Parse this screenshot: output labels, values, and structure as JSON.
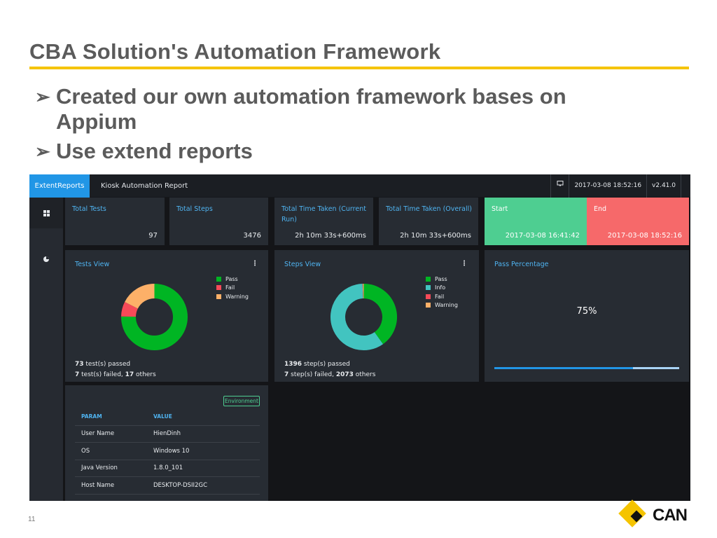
{
  "slide": {
    "title": "CBA Solution's Automation Framework",
    "bullets": [
      "Created our own automation framework bases on Appium",
      "Use extend reports"
    ],
    "page_number": "11",
    "logo_text": "CAN",
    "accent_color": "#f5c400"
  },
  "app": {
    "brand": "ExtentReports",
    "report_name": "Kiosk Automation Report",
    "topbar": {
      "monitor_icon": "monitor-icon",
      "datetime": "2017-03-08 18:52:16",
      "version": "v2.41.0"
    },
    "nav": [
      {
        "icon": "dashboard-icon",
        "active": true
      },
      {
        "icon": "pie-chart-icon",
        "active": false
      }
    ],
    "stats": [
      {
        "label": "Total Tests",
        "value": "97"
      },
      {
        "label": "Total Steps",
        "value": "3476"
      },
      {
        "label": "Total Time Taken (Current Run)",
        "value": "2h 10m 33s+600ms"
      },
      {
        "label": "Total Time Taken (Overall)",
        "value": "2h 10m 33s+600ms"
      },
      {
        "label": "Start",
        "value": "2017-03-08 16:41:42",
        "color": "#4ece91"
      },
      {
        "label": "End",
        "value": "2017-03-08 18:52:16",
        "color": "#f6696a"
      }
    ],
    "tests_view": {
      "title": "Tests View",
      "legend": [
        {
          "label": "Pass",
          "color": "#00b523"
        },
        {
          "label": "Fail",
          "color": "#f74a58"
        },
        {
          "label": "Warning",
          "color": "#fdb068"
        }
      ],
      "summary_line1_num": "73",
      "summary_line1_text": " test(s) passed",
      "summary_line2_num_a": "7",
      "summary_line2_mid": " test(s) failed, ",
      "summary_line2_num_b": "17",
      "summary_line2_end": " others"
    },
    "steps_view": {
      "title": "Steps View",
      "legend": [
        {
          "label": "Pass",
          "color": "#00b523"
        },
        {
          "label": "Info",
          "color": "#42c4c0"
        },
        {
          "label": "Fail",
          "color": "#f74a58"
        },
        {
          "label": "Warning",
          "color": "#fdb068"
        }
      ],
      "summary_line1_num": "1396",
      "summary_line1_text": " step(s) passed",
      "summary_line2_num_a": "7",
      "summary_line2_mid": " step(s) failed, ",
      "summary_line2_num_b": "2073",
      "summary_line2_end": " others"
    },
    "pass_percentage": {
      "title": "Pass Percentage",
      "value_text": "75%",
      "fraction": 0.75
    },
    "environment": {
      "button_label": "Environment",
      "headers": [
        "PARAM",
        "VALUE"
      ],
      "rows": [
        [
          "User Name",
          "HienDinh"
        ],
        [
          "OS",
          "Windows 10"
        ],
        [
          "Java Version",
          "1.8.0_101"
        ],
        [
          "Host Name",
          "DESKTOP-DSII2GC"
        ]
      ]
    }
  },
  "chart_data": [
    {
      "type": "pie",
      "title": "Tests View",
      "categories": [
        "Pass",
        "Fail",
        "Warning"
      ],
      "values": [
        73,
        7,
        17
      ]
    },
    {
      "type": "pie",
      "title": "Steps View",
      "categories": [
        "Pass",
        "Info",
        "Fail",
        "Warning"
      ],
      "values": [
        1396,
        2059,
        7,
        14
      ]
    }
  ]
}
